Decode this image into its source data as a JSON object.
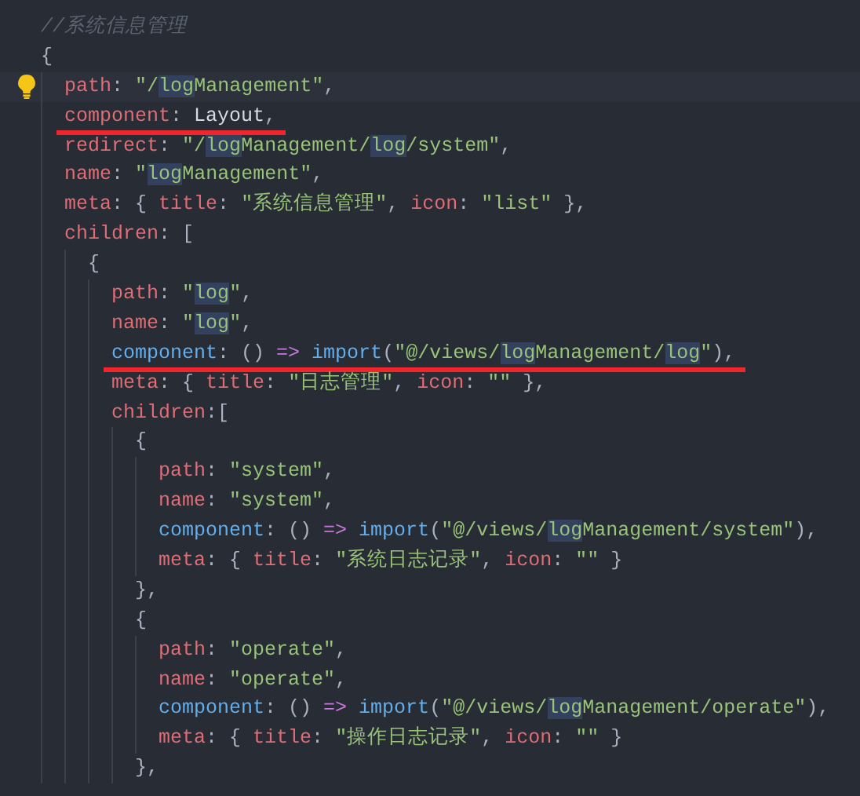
{
  "editor": {
    "lines": [
      {
        "tokens": [
          {
            "kind": "comment",
            "text": "//系统信息管理"
          }
        ]
      },
      {
        "tokens": [
          {
            "kind": "punct",
            "text": "{"
          }
        ],
        "children": [
          {
            "current": true,
            "tokens": [
              {
                "kind": "key",
                "text": "path"
              },
              {
                "kind": "punct",
                "text": ": "
              },
              {
                "kind": "str",
                "text": "\"/"
              },
              {
                "kind": "match",
                "text": "log"
              },
              {
                "kind": "str",
                "text": "Management\""
              },
              {
                "kind": "punct",
                "text": ","
              }
            ]
          },
          {
            "underlined": true,
            "tokens": [
              {
                "kind": "key",
                "text": "component"
              },
              {
                "kind": "punct",
                "text": ": "
              },
              {
                "kind": "plain",
                "text": "Layout"
              },
              {
                "kind": "punct",
                "text": ","
              }
            ]
          },
          {
            "tokens": [
              {
                "kind": "key",
                "text": "redirect"
              },
              {
                "kind": "punct",
                "text": ": "
              },
              {
                "kind": "str",
                "text": "\"/"
              },
              {
                "kind": "match",
                "text": "log"
              },
              {
                "kind": "str",
                "text": "Management/"
              },
              {
                "kind": "match",
                "text": "log"
              },
              {
                "kind": "str",
                "text": "/system\""
              },
              {
                "kind": "punct",
                "text": ","
              }
            ]
          },
          {
            "tokens": [
              {
                "kind": "key",
                "text": "name"
              },
              {
                "kind": "punct",
                "text": ": "
              },
              {
                "kind": "str",
                "text": "\""
              },
              {
                "kind": "match",
                "text": "log"
              },
              {
                "kind": "str",
                "text": "Management\""
              },
              {
                "kind": "punct",
                "text": ","
              }
            ]
          },
          {
            "tokens": [
              {
                "kind": "key",
                "text": "meta"
              },
              {
                "kind": "punct",
                "text": ": { "
              },
              {
                "kind": "key",
                "text": "title"
              },
              {
                "kind": "punct",
                "text": ": "
              },
              {
                "kind": "str",
                "text": "\"系统信息管理\""
              },
              {
                "kind": "punct",
                "text": ", "
              },
              {
                "kind": "key",
                "text": "icon"
              },
              {
                "kind": "punct",
                "text": ": "
              },
              {
                "kind": "str",
                "text": "\"list\""
              },
              {
                "kind": "punct",
                "text": " },"
              }
            ]
          },
          {
            "tokens": [
              {
                "kind": "key",
                "text": "children"
              },
              {
                "kind": "punct",
                "text": ": ["
              }
            ],
            "children": [
              {
                "tokens": [
                  {
                    "kind": "punct",
                    "text": "{"
                  }
                ],
                "children": [
                  {
                    "tokens": [
                      {
                        "kind": "key",
                        "text": "path"
                      },
                      {
                        "kind": "punct",
                        "text": ": "
                      },
                      {
                        "kind": "str",
                        "text": "\""
                      },
                      {
                        "kind": "match",
                        "text": "log"
                      },
                      {
                        "kind": "str",
                        "text": "\""
                      },
                      {
                        "kind": "punct",
                        "text": ","
                      }
                    ]
                  },
                  {
                    "tokens": [
                      {
                        "kind": "key",
                        "text": "name"
                      },
                      {
                        "kind": "punct",
                        "text": ": "
                      },
                      {
                        "kind": "str",
                        "text": "\""
                      },
                      {
                        "kind": "match",
                        "text": "log"
                      },
                      {
                        "kind": "str",
                        "text": "\""
                      },
                      {
                        "kind": "punct",
                        "text": ","
                      }
                    ]
                  },
                  {
                    "underlined": true,
                    "tokens": [
                      {
                        "kind": "fn",
                        "text": "component"
                      },
                      {
                        "kind": "punct",
                        "text": ": () "
                      },
                      {
                        "kind": "op",
                        "text": "=>"
                      },
                      {
                        "kind": "fn",
                        "text": "import"
                      },
                      {
                        "kind": "punct",
                        "text": "("
                      },
                      {
                        "kind": "str",
                        "text": "\"@/views/"
                      },
                      {
                        "kind": "match",
                        "text": "log"
                      },
                      {
                        "kind": "str",
                        "text": "Management/"
                      },
                      {
                        "kind": "match",
                        "text": "log"
                      },
                      {
                        "kind": "str",
                        "text": "\""
                      },
                      {
                        "kind": "punct",
                        "text": "),"
                      }
                    ]
                  },
                  {
                    "tokens": [
                      {
                        "kind": "key",
                        "text": "meta"
                      },
                      {
                        "kind": "punct",
                        "text": ": { "
                      },
                      {
                        "kind": "key",
                        "text": "title"
                      },
                      {
                        "kind": "punct",
                        "text": ": "
                      },
                      {
                        "kind": "str",
                        "text": "\"日志管理\""
                      },
                      {
                        "kind": "punct",
                        "text": ", "
                      },
                      {
                        "kind": "key",
                        "text": "icon"
                      },
                      {
                        "kind": "punct",
                        "text": ": "
                      },
                      {
                        "kind": "str",
                        "text": "\"\""
                      },
                      {
                        "kind": "punct",
                        "text": " },"
                      }
                    ]
                  },
                  {
                    "tokens": [
                      {
                        "kind": "key",
                        "text": "children"
                      },
                      {
                        "kind": "punct",
                        "text": ":["
                      }
                    ],
                    "children": [
                      {
                        "tokens": [
                          {
                            "kind": "punct",
                            "text": "{"
                          }
                        ],
                        "children": [
                          {
                            "tokens": [
                              {
                                "kind": "key",
                                "text": "path"
                              },
                              {
                                "kind": "punct",
                                "text": ": "
                              },
                              {
                                "kind": "str",
                                "text": "\"system\""
                              },
                              {
                                "kind": "punct",
                                "text": ","
                              }
                            ]
                          },
                          {
                            "tokens": [
                              {
                                "kind": "key",
                                "text": "name"
                              },
                              {
                                "kind": "punct",
                                "text": ": "
                              },
                              {
                                "kind": "str",
                                "text": "\"system\""
                              },
                              {
                                "kind": "punct",
                                "text": ","
                              }
                            ]
                          },
                          {
                            "tokens": [
                              {
                                "kind": "fn",
                                "text": "component"
                              },
                              {
                                "kind": "punct",
                                "text": ": () "
                              },
                              {
                                "kind": "op",
                                "text": "=>"
                              },
                              {
                                "kind": "fn",
                                "text": "import"
                              },
                              {
                                "kind": "punct",
                                "text": "("
                              },
                              {
                                "kind": "str",
                                "text": "\"@/views/"
                              },
                              {
                                "kind": "match",
                                "text": "log"
                              },
                              {
                                "kind": "str",
                                "text": "Management/system\""
                              },
                              {
                                "kind": "punct",
                                "text": "),"
                              }
                            ]
                          },
                          {
                            "tokens": [
                              {
                                "kind": "key",
                                "text": "meta"
                              },
                              {
                                "kind": "punct",
                                "text": ": { "
                              },
                              {
                                "kind": "key",
                                "text": "title"
                              },
                              {
                                "kind": "punct",
                                "text": ": "
                              },
                              {
                                "kind": "str",
                                "text": "\"系统日志记录\""
                              },
                              {
                                "kind": "punct",
                                "text": ", "
                              },
                              {
                                "kind": "key",
                                "text": "icon"
                              },
                              {
                                "kind": "punct",
                                "text": ": "
                              },
                              {
                                "kind": "str",
                                "text": "\"\""
                              },
                              {
                                "kind": "punct",
                                "text": " }"
                              }
                            ]
                          }
                        ]
                      },
                      {
                        "tokens": [
                          {
                            "kind": "punct",
                            "text": "},"
                          }
                        ]
                      },
                      {
                        "tokens": [
                          {
                            "kind": "punct",
                            "text": "{"
                          }
                        ],
                        "children": [
                          {
                            "tokens": [
                              {
                                "kind": "key",
                                "text": "path"
                              },
                              {
                                "kind": "punct",
                                "text": ": "
                              },
                              {
                                "kind": "str",
                                "text": "\"operate\""
                              },
                              {
                                "kind": "punct",
                                "text": ","
                              }
                            ]
                          },
                          {
                            "tokens": [
                              {
                                "kind": "key",
                                "text": "name"
                              },
                              {
                                "kind": "punct",
                                "text": ": "
                              },
                              {
                                "kind": "str",
                                "text": "\"operate\""
                              },
                              {
                                "kind": "punct",
                                "text": ","
                              }
                            ]
                          },
                          {
                            "tokens": [
                              {
                                "kind": "fn",
                                "text": "component"
                              },
                              {
                                "kind": "punct",
                                "text": ": () "
                              },
                              {
                                "kind": "op",
                                "text": "=>"
                              },
                              {
                                "kind": "fn",
                                "text": "import"
                              },
                              {
                                "kind": "punct",
                                "text": "("
                              },
                              {
                                "kind": "str",
                                "text": "\"@/views/"
                              },
                              {
                                "kind": "match",
                                "text": "log"
                              },
                              {
                                "kind": "str",
                                "text": "Management/operate\""
                              },
                              {
                                "kind": "punct",
                                "text": "),"
                              }
                            ]
                          },
                          {
                            "tokens": [
                              {
                                "kind": "key",
                                "text": "meta"
                              },
                              {
                                "kind": "punct",
                                "text": ": { "
                              },
                              {
                                "kind": "key",
                                "text": "title"
                              },
                              {
                                "kind": "punct",
                                "text": ": "
                              },
                              {
                                "kind": "str",
                                "text": "\"操作日志记录\""
                              },
                              {
                                "kind": "punct",
                                "text": ", "
                              },
                              {
                                "kind": "key",
                                "text": "icon"
                              },
                              {
                                "kind": "punct",
                                "text": ": "
                              },
                              {
                                "kind": "str",
                                "text": "\"\""
                              },
                              {
                                "kind": "punct",
                                "text": " }"
                              }
                            ]
                          }
                        ]
                      },
                      {
                        "tokens": [
                          {
                            "kind": "punct",
                            "text": "},"
                          }
                        ]
                      }
                    ]
                  }
                ]
              }
            ]
          }
        ]
      }
    ]
  }
}
